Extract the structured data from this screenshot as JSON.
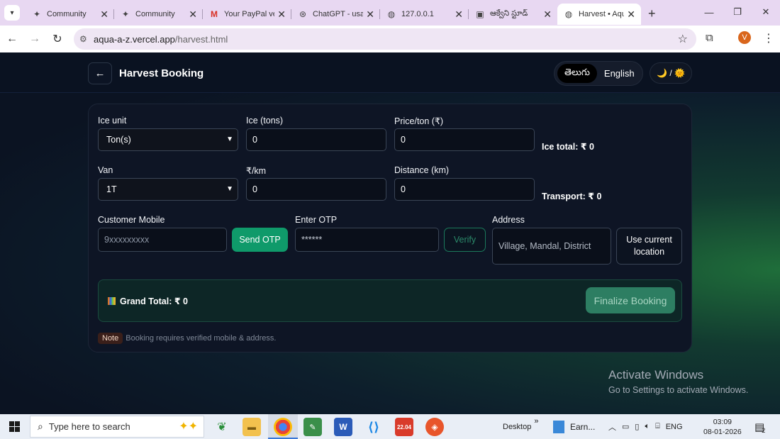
{
  "browser": {
    "tabs": [
      {
        "title": "Community",
        "favicon": "diamond-icon"
      },
      {
        "title": "Community",
        "favicon": "diamond-icon"
      },
      {
        "title": "Your PayPal ve",
        "favicon": "gmail-icon"
      },
      {
        "title": "ChatGPT - usa",
        "favicon": "chatgpt-icon"
      },
      {
        "title": "127.0.0.1",
        "favicon": "globe-icon"
      },
      {
        "title": "ఆక్వేని స్టూడ్",
        "favicon": "page-icon"
      },
      {
        "title": "Harvest • Aqu",
        "favicon": "globe-icon",
        "active": true
      }
    ],
    "url_host": "aqua-a-z.vercel.app",
    "url_path": "/harvest.html",
    "profile_initial": "V"
  },
  "header": {
    "back_label": "←",
    "title": "Harvest Booking",
    "lang_telugu": "తెలుగు",
    "lang_english": "English",
    "theme_toggle": "🌙 / 🌞"
  },
  "form": {
    "ice_unit_label": "Ice unit",
    "ice_unit_value": "Ton(s)",
    "ice_tons_label": "Ice (tons)",
    "ice_tons_value": "0",
    "price_label": "Price/ton (₹)",
    "price_value": "0",
    "ice_total": "Ice total: ₹ 0",
    "van_label": "Van",
    "van_value": "1T",
    "per_km_label": "₹/km",
    "per_km_value": "0",
    "distance_label": "Distance (km)",
    "distance_value": "0",
    "transport_total": "Transport: ₹ 0",
    "mobile_label": "Customer Mobile",
    "mobile_placeholder": "9xxxxxxxxx",
    "send_otp": "Send OTP",
    "otp_label": "Enter OTP",
    "otp_placeholder": "******",
    "verify": "Verify",
    "address_label": "Address",
    "address_placeholder": "Village, Mandal, District",
    "use_location_line1": "Use current",
    "use_location_line2": "location",
    "grand_total": "Grand Total: ₹ 0",
    "finalize": "Finalize Booking",
    "note_tag": "Note",
    "note_text": "Booking requires verified mobile & address."
  },
  "watermark": {
    "line1": "Activate Windows",
    "line2": "Go to Settings to activate Windows."
  },
  "taskbar": {
    "search_placeholder": "Type here to search",
    "desktop_label": "Desktop",
    "app_label": "Earn...",
    "lang": "ENG",
    "time": "03:09",
    "date": "08-01-2026",
    "notif_count": "2",
    "calendar_day": "22.04"
  }
}
